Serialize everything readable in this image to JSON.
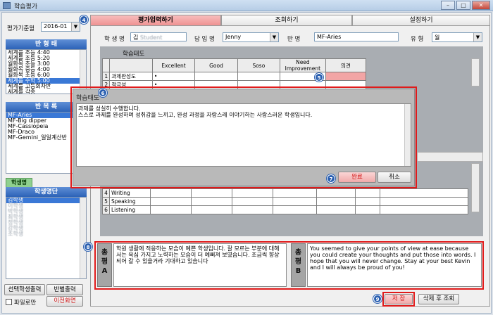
{
  "window": {
    "title": "학습평가"
  },
  "left": {
    "period_label": "평가기준월",
    "period_value": "2016-01",
    "class_type_header": "반 형 태",
    "class_types": [
      {
        "label": "세계를 조등 4:40",
        "selected": false
      },
      {
        "label": "세계를 조등 5:20",
        "selected": false
      },
      {
        "label": "월화목 초등 3:00",
        "selected": false
      },
      {
        "label": "월화목 중등 4:00",
        "selected": false
      },
      {
        "label": "월화목 초등 6:00",
        "selected": false
      },
      {
        "label": "세계를 수학 5:00",
        "selected": true
      },
      {
        "label": "세계를 고등회차반",
        "selected": false
      },
      {
        "label": "세계를 각종",
        "selected": false
      }
    ],
    "class_name_header": "반 목 록",
    "class_names": [
      {
        "label": "MF-Aries",
        "selected": true
      },
      {
        "label": "MF-Big dipper",
        "selected": false
      },
      {
        "label": "MF-Cassiopeia",
        "selected": false
      },
      {
        "label": "MF-Draco",
        "selected": false
      },
      {
        "label": "MF-Gemini_일일계산반",
        "selected": false
      }
    ],
    "student_tab": "학생명",
    "student_header": "학생명단",
    "students": [
      {
        "label": "김학생",
        "selected": true
      },
      {
        "label": "이학생",
        "selected": false
      },
      {
        "label": "박학생",
        "selected": false
      },
      {
        "label": "최학생",
        "selected": false
      },
      {
        "label": "정학생",
        "selected": false
      },
      {
        "label": "강학생",
        "selected": false
      },
      {
        "label": "조학생",
        "selected": false
      }
    ],
    "btn_print_selected": "선택학생출력",
    "btn_print_class": "반별출력",
    "file_only_label": "파일로만",
    "btn_prev_screen": "이전화면"
  },
  "tabs": [
    {
      "label": "평가입력하기",
      "active": true
    },
    {
      "label": "조회하기",
      "active": false
    },
    {
      "label": "설정하기",
      "active": false
    }
  ],
  "info": {
    "student_label": "학 생 명",
    "student_value": "김",
    "teacher_label": "담 임 명",
    "teacher_value": "Jenny",
    "class_label": "반 명",
    "class_value": "MF-Aries",
    "type_label": "유 형",
    "type_value": "월"
  },
  "grid1": {
    "caption": "학습태도",
    "headers": [
      "Excellent",
      "Good",
      "Soso",
      "Need Improvement",
      "의견"
    ],
    "rows": [
      {
        "num": "1",
        "label": "과제완성도",
        "marks": [
          "•",
          "",
          "",
          ""
        ]
      },
      {
        "num": "2",
        "label": "적극성",
        "marks": [
          "•",
          "",
          "",
          ""
        ]
      }
    ]
  },
  "grid2": {
    "rows": [
      {
        "num": "4",
        "label": "Writing"
      },
      {
        "num": "5",
        "label": "Speaking"
      },
      {
        "num": "6",
        "label": "Listening"
      }
    ]
  },
  "dialog": {
    "title": "학습태도",
    "text": "과제를 성실히 수행합니다.\n스스로 과제를 완성하며 성취감을 느끼고, 완성 과정을 자랑스레 이야기하는 사랑스러운 학생입니다.",
    "ok": "완료",
    "cancel": "취소"
  },
  "comments": {
    "label_a_1": "총",
    "label_a_2": "평",
    "label_a_3": "A",
    "text_a": "학원 생활에 적응하는 모습이 예쁜 학생입니다. 잘 모르는 부분에 대해서는 욕심 가지고 노력하는 모습이 더 예뻐져 보였습니다. 조금씩 향상되어 갈 수 있을거라 기대하고 있습니다",
    "label_b_1": "총",
    "label_b_2": "평",
    "label_b_3": "B",
    "text_b": "You seemed to give your points of view at ease because you could create your thoughts and put those into words. I hope that you will never change. Stay at your best Kevin and I will always be proud of you!"
  },
  "actions": {
    "save": "저 장",
    "delete_refresh": "삭제 후 조회"
  },
  "badges": [
    "4",
    "5",
    "6",
    "7",
    "8",
    "9"
  ]
}
